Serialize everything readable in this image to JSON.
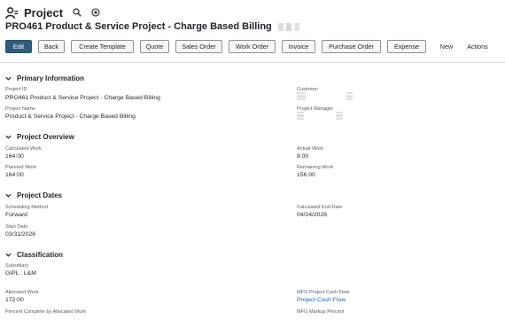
{
  "header": {
    "record_type": "Project",
    "title": "PRO461 Product & Service Project - Charge Based Billing"
  },
  "toolbar": {
    "buttons": [
      {
        "label": "Edit"
      },
      {
        "label": "Back"
      },
      {
        "label": "Create Template"
      },
      {
        "label": "Quote"
      },
      {
        "label": "Sales Order"
      },
      {
        "label": "Work Order"
      },
      {
        "label": "Invoice"
      },
      {
        "label": "Purchase Order"
      },
      {
        "label": "Expense"
      },
      {
        "label": "New"
      },
      {
        "label": "Actions"
      }
    ]
  },
  "sections": {
    "primary": {
      "title": "Primary Information",
      "project_id_label": "Project ID",
      "project_id_value": "PRO461 Product & Service Project - Charge Based Billing",
      "project_name_label": "Project Name",
      "project_name_value": "Product & Service Project - Charge Based Billing",
      "customer_label": "Customer",
      "project_manager_label": "Project Manager"
    },
    "overview": {
      "title": "Project Overview",
      "calculated_work_label": "Calculated Work",
      "calculated_work_value": "164:00",
      "planned_work_label": "Planned Work",
      "planned_work_value": "164:00",
      "actual_work_label": "Actual Work",
      "actual_work_value": "8:00",
      "remaining_work_label": "Remaining Work",
      "remaining_work_value": "156:00"
    },
    "dates": {
      "title": "Project Dates",
      "scheduling_method_label": "Scheduling Method",
      "scheduling_method_value": "Forward",
      "start_date_label": "Start Date",
      "start_date_value": "03/31/2026",
      "calc_end_date_label": "Calculated End Date",
      "calc_end_date_value": "04/24/2026"
    },
    "classification": {
      "title": "Classification",
      "subsidiary_label": "Subsidiary",
      "subsidiary_value": "GIPL : L&M",
      "allocated_work_label": "Allocated Work",
      "allocated_work_value": "172:00",
      "percent_complete_label": "Percent Complete by Allocated Work",
      "cash_flow_label": "MFG Project Cash Flow",
      "cash_flow_value": "Project Cash Flow",
      "markup_label": "MFG Markup Percent"
    }
  },
  "colors": {
    "primary_button": "#2f5b7c",
    "link": "#1f62a8"
  }
}
